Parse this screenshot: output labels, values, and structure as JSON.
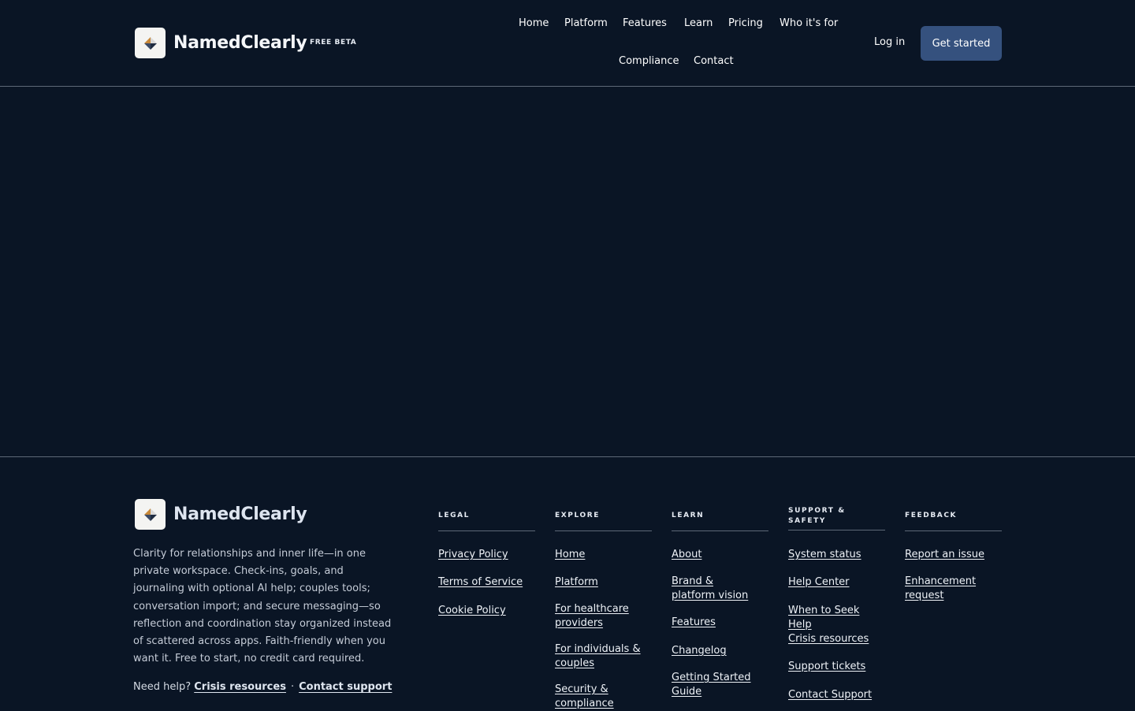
{
  "header": {
    "brand": "NamedClearly",
    "badge": "FREE BETA",
    "nav": [
      "Home",
      "Platform",
      "Features",
      "Learn",
      "Pricing",
      "Who it's for",
      "Compliance",
      "Contact"
    ],
    "login": "Log in",
    "cta": "Get started"
  },
  "footer": {
    "brand": "NamedClearly",
    "description": "Clarity for relationships and inner life—in one private workspace. Check-ins, goals, and journaling with optional AI help; couples tools; conversation import; and secure messaging—so reflection and coordination stay organized instead of scattered across apps. Faith-friendly when you want it. Free to start, no credit card required.",
    "help_prefix": "Need help?",
    "help_links": [
      "Crisis resources",
      "Contact support"
    ],
    "help_separator": "·",
    "columns": [
      {
        "heading": "LEGAL",
        "links": [
          "Privacy Policy",
          "Terms of Service",
          "Cookie Policy"
        ]
      },
      {
        "heading": "EXPLORE",
        "links": [
          "Home",
          "Platform",
          "For healthcare providers",
          "For individuals & couples",
          "Security & compliance"
        ]
      },
      {
        "heading": "LEARN",
        "links": [
          "About",
          "Brand & platform vision",
          "Features",
          "Changelog",
          "Getting Started Guide"
        ]
      },
      {
        "heading": "SUPPORT & SAFETY",
        "links": [
          "System status",
          "Help Center",
          "When to Seek Help",
          "Crisis resources",
          "Support tickets",
          "Contact Support"
        ]
      },
      {
        "heading": "FEEDBACK",
        "links": [
          "Report an issue",
          "Enhancement request"
        ]
      }
    ]
  },
  "colors": {
    "background": "#0a1525",
    "accent_button": "#35517e",
    "divider": "#5d6877"
  },
  "icons": {
    "logo": "diamond-compass-logo-icon"
  }
}
